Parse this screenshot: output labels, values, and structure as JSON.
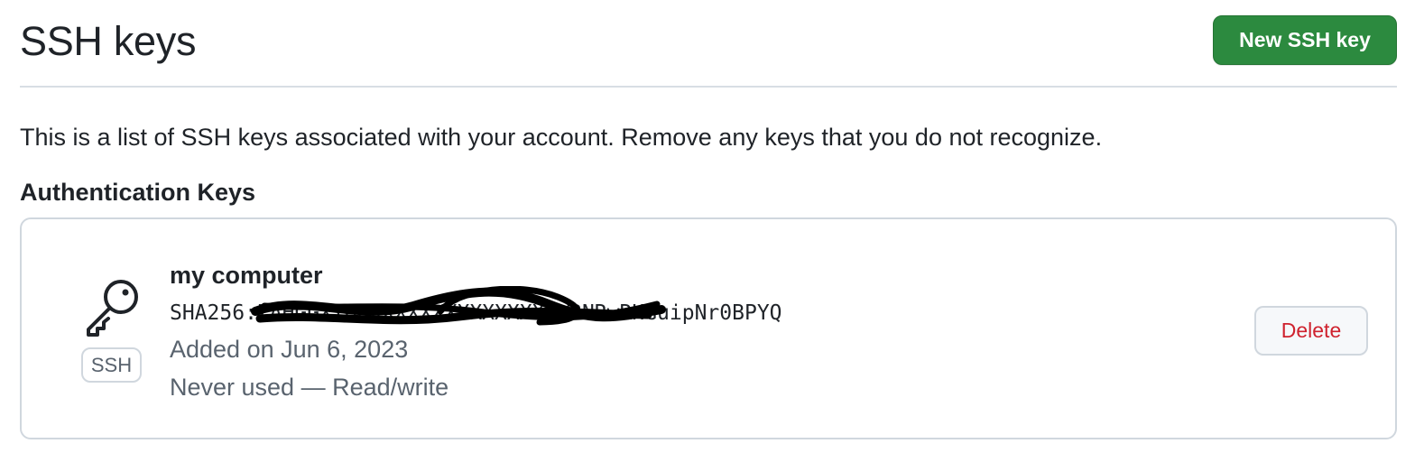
{
  "header": {
    "title": "SSH keys",
    "new_key_button": "New SSH key"
  },
  "description": "This is a list of SSH keys associated with your account. Remove any keys that you do not recognize.",
  "section": {
    "heading": "Authentication Keys"
  },
  "key": {
    "icon": "key-icon",
    "badge": "SSH",
    "name": "my computer",
    "fingerprint": "SHA256:ZAHGGXIGUXXXXXXXXXXXXXXXWRNRwRHGuipNr0BPYQ",
    "added": "Added on Jun 6, 2023",
    "usage": "Never used — Read/write",
    "delete_button": "Delete"
  },
  "colors": {
    "primary_button": "#2c8a3f",
    "danger_text": "#cf222e",
    "muted_text": "#59636e",
    "border": "#d0d7de"
  }
}
